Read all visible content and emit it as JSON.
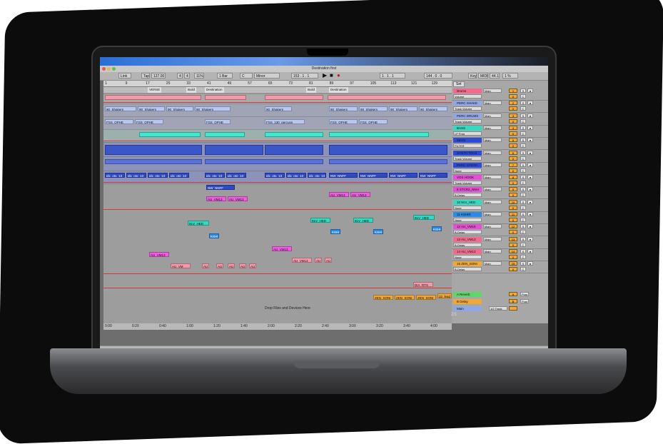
{
  "window": {
    "title": "Destination first"
  },
  "transport": {
    "link": "Link",
    "tap": "Tap",
    "tempo": "127.00",
    "sig_num": "4",
    "sig_den": "4",
    "percent": "11%",
    "quant": "1 Bar",
    "key_root": "C",
    "scale": "Minor",
    "position": "153 . 1 . 1",
    "loop_start": "1 . 1 . 1",
    "loop_len": "144 . 0 . 0",
    "key_label": "Key",
    "midi_label": "MIDI",
    "sample_rate": "44.1",
    "cpu": "1 %"
  },
  "ruler": {
    "bars": [
      "1",
      "9",
      "17",
      "25",
      "33",
      "41",
      "49",
      "57",
      "65",
      "73",
      "81",
      "89",
      "97",
      "105",
      "113",
      "121",
      "129"
    ]
  },
  "locators": [
    "VERSE",
    "Build",
    "Destination",
    "Build",
    "Destination"
  ],
  "time_ruler": [
    "0:00",
    "0:20",
    "0:40",
    "1:00",
    "1:20",
    "1:40",
    "2:00",
    "2:20",
    "2:40",
    "3:00",
    "3:20",
    "3:40",
    "4:00"
  ],
  "clips": {
    "shakers": "90_Shakers",
    "fss": "FSS_OPHE",
    "plx": "plx_oto_13",
    "nw": "NW_NNFF",
    "au_vm13": "AU_VM13",
    "au_vm": "AU_VM",
    "au": "AU",
    "v91": "91V_HED",
    "kshi": "KSHI",
    "zen": "ZEN_SONI",
    "dia": "DIA_RTS",
    "lead": "22_lead_ssi",
    "fss_perc": "FSS_130_percuss"
  },
  "drop_hint": "Drop Files and Devices Here",
  "set_label": "Set",
  "tracks": [
    {
      "name": "Drums",
      "sub": "Volume",
      "route": "Main",
      "num": "1",
      "vol": "0",
      "color": "#f26a8d"
    },
    {
      "name": "PERC SHAKE",
      "sub": "Track Volume",
      "route": "Main",
      "num": "2",
      "vol": "0",
      "color": "#8fa7e6"
    },
    {
      "name": "PERC DRUMS",
      "sub": "Track Volume",
      "route": "Main",
      "num": "3",
      "vol": "0",
      "color": "#8fa7e6"
    },
    {
      "name": "BASS",
      "sub": "LP Freq",
      "route": "Main",
      "num": "4",
      "vol": "0",
      "color": "#34d9c0"
    },
    {
      "name": "KEYS",
      "sub": "FILTER",
      "route": "Main",
      "num": "5",
      "vol": "0",
      "color": "#2d4bd6"
    },
    {
      "name": "SYNTH TRAX",
      "sub": "Track Volume",
      "route": "Main",
      "num": "6",
      "vol": "0",
      "color": "#2d4bd6"
    },
    {
      "name": "PERC SYNTH",
      "sub": "None",
      "route": "Main",
      "num": "7",
      "vol": "0",
      "color": "#2d4bd6"
    },
    {
      "name": "VOX HOOK",
      "sub": "Track Volume",
      "route": "Main",
      "num": "8",
      "vol": "0",
      "color": "#e64ed6"
    },
    {
      "name": "9 STCR2_NNH",
      "sub": "B-Delay",
      "route": "Main",
      "num": "9",
      "vol": "0",
      "color": "#e64ed6"
    },
    {
      "name": "10 91V_HED",
      "sub": "None",
      "route": "Main",
      "num": "10",
      "vol": "0",
      "color": "#34d9c0"
    },
    {
      "name": "11 KSHIR",
      "sub": "None",
      "route": "Main",
      "num": "11",
      "vol": "0",
      "color": "#2d8be6"
    },
    {
      "name": "12 AU_VM15",
      "sub": "B-Delay",
      "route": "Main",
      "num": "12",
      "vol": "0",
      "color": "#e64ed6"
    },
    {
      "name": "13 AU_VM13",
      "sub": "B-Delay",
      "route": "Main",
      "num": "13",
      "vol": "0",
      "color": "#f26a8d"
    },
    {
      "name": "14 AU_VM13",
      "sub": "None",
      "route": "Main",
      "num": "14",
      "vol": "0",
      "color": "#f26a8d"
    },
    {
      "name": "15 ZEN_SONI",
      "sub": "B-Delay",
      "route": "Main",
      "num": "15",
      "vol": "0",
      "color": "#f1a83a"
    }
  ],
  "returns": [
    {
      "name": "A Reverb",
      "num": "A",
      "vol": "0",
      "post": "Post",
      "color": "#5fd66a"
    },
    {
      "name": "B Delay",
      "num": "B",
      "vol": "0",
      "post": "Post",
      "color": "#f1a83a"
    },
    {
      "name": "Main",
      "route": "1/2 Track",
      "num": "",
      "vol": "0",
      "color": "#8fa7e6"
    }
  ],
  "status": {
    "selection": "Start: 41.1.1  End: 57.1.1  Length: 16.0.0",
    "clip_name": "10-91V_HED_140_drum_fill_snare ...",
    "page": "2/1"
  }
}
